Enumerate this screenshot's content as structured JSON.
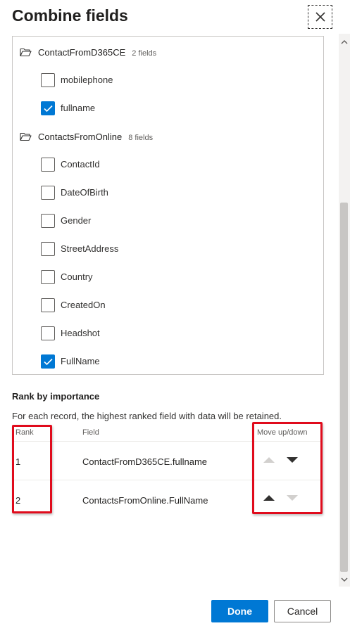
{
  "panel": {
    "title": "Combine fields",
    "close_icon": "close-icon"
  },
  "field_list": {
    "groups": [
      {
        "name": "ContactFromD365CE",
        "count": "2 fields",
        "fields": [
          {
            "label": "mobilephone",
            "checked": false
          },
          {
            "label": "fullname",
            "checked": true
          }
        ]
      },
      {
        "name": "ContactsFromOnline",
        "count": "8 fields",
        "fields": [
          {
            "label": "ContactId",
            "checked": false
          },
          {
            "label": "DateOfBirth",
            "checked": false
          },
          {
            "label": "Gender",
            "checked": false
          },
          {
            "label": "StreetAddress",
            "checked": false
          },
          {
            "label": "Country",
            "checked": false
          },
          {
            "label": "CreatedOn",
            "checked": false
          },
          {
            "label": "Headshot",
            "checked": false
          },
          {
            "label": "FullName",
            "checked": true
          }
        ]
      }
    ]
  },
  "ranking": {
    "title": "Rank by importance",
    "description": "For each record, the highest ranked field with data will be retained.",
    "columns": {
      "rank": "Rank",
      "field": "Field",
      "move": "Move up/down"
    },
    "rows": [
      {
        "rank": "1",
        "field": "ContactFromD365CE.fullname",
        "up_enabled": false,
        "down_enabled": true
      },
      {
        "rank": "2",
        "field": "ContactsFromOnline.FullName",
        "up_enabled": true,
        "down_enabled": false
      }
    ]
  },
  "footer": {
    "done_label": "Done",
    "cancel_label": "Cancel"
  },
  "colors": {
    "accent": "#0078d4",
    "highlight": "#e00b1c",
    "arrow_enabled": "#323130",
    "arrow_disabled": "#c8c6c4"
  }
}
